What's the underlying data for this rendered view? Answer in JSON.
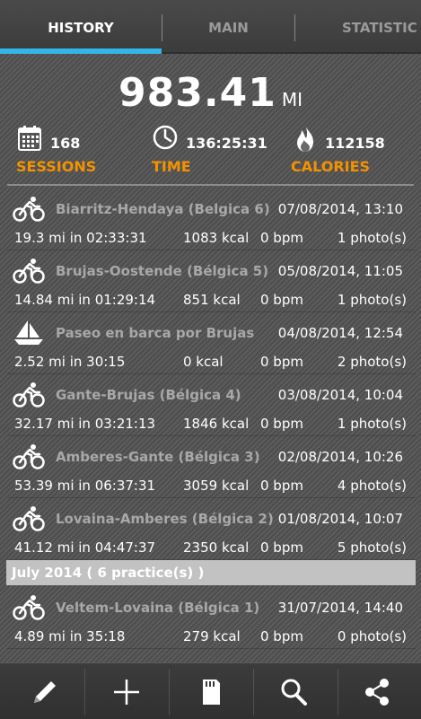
{
  "tabs": [
    {
      "label": "HISTORY",
      "active": true
    },
    {
      "label": "MAIN",
      "active": false
    },
    {
      "label": "STATISTIC",
      "active": false
    }
  ],
  "summary": {
    "distance": "983.41",
    "distance_unit": "MI",
    "sessions": {
      "value": "168",
      "label": "SESSIONS",
      "icon": "calendar-icon"
    },
    "time": {
      "value": "136:25:31",
      "label": "TIME",
      "icon": "clock-icon"
    },
    "calories": {
      "value": "112158",
      "label": "CALORIES",
      "icon": "flame-icon"
    }
  },
  "activities": [
    {
      "icon": "bicycle-icon",
      "name": "Biarritz-Hendaya (Belgica 6)",
      "date": "07/08/2014, 13:10",
      "distance_time": "19.3 mi in 02:33:31",
      "kcal": "1083 kcal",
      "bpm": "0 bpm",
      "photos": "1 photo(s)"
    },
    {
      "icon": "bicycle-icon",
      "name": "Brujas-Oostende (Bélgica 5)",
      "date": "05/08/2014, 11:05",
      "distance_time": "14.84 mi in 01:29:14",
      "kcal": "851 kcal",
      "bpm": "0 bpm",
      "photos": "1 photo(s)"
    },
    {
      "icon": "sailboat-icon",
      "name": "Paseo en barca por Brujas",
      "date": "04/08/2014, 12:54",
      "distance_time": "2.52 mi in 30:15",
      "kcal": "0 kcal",
      "bpm": "0 bpm",
      "photos": "2 photo(s)"
    },
    {
      "icon": "bicycle-icon",
      "name": "Gante-Brujas (Bélgica 4)",
      "date": "03/08/2014, 10:04",
      "distance_time": "32.17 mi in 03:21:13",
      "kcal": "1846 kcal",
      "bpm": "0 bpm",
      "photos": "1 photo(s)"
    },
    {
      "icon": "bicycle-icon",
      "name": "Amberes-Gante (Bélgica 3)",
      "date": "02/08/2014, 10:26",
      "distance_time": "53.39 mi in 06:37:31",
      "kcal": "3059 kcal",
      "bpm": "0 bpm",
      "photos": "4 photo(s)"
    },
    {
      "icon": "bicycle-icon",
      "name": "Lovaina-Amberes (Bélgica 2)",
      "date": "01/08/2014, 10:07",
      "distance_time": "41.12 mi in 04:47:37",
      "kcal": "2350 kcal",
      "bpm": "0 bpm",
      "photos": "5 photo(s)"
    }
  ],
  "month_header": "July 2014 ( 6 practice(s) )",
  "july_activities": [
    {
      "icon": "bicycle-icon",
      "name": "Veltem-Lovaina (Bélgica 1)",
      "date": "31/07/2014, 14:40",
      "distance_time": "4.89 mi in 35:18",
      "kcal": "279 kcal",
      "bpm": "0 bpm",
      "photos": "0 photo(s)"
    }
  ],
  "bottom_bar": [
    "edit-icon",
    "add-icon",
    "sd-card-icon",
    "search-icon",
    "share-icon"
  ],
  "colors": {
    "accent_orange": "#f39200",
    "tab_indicator": "#33b5e5",
    "month_header_bg": "#c2c2c2"
  }
}
